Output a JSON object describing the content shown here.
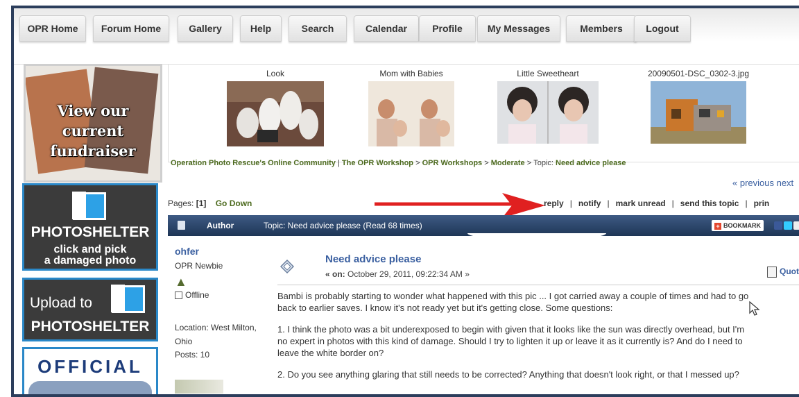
{
  "nav": {
    "items": [
      "OPR Home",
      "Forum Home",
      "Gallery",
      "Help",
      "Search",
      "Calendar",
      "Profile",
      "My Messages",
      "Members",
      "Logout"
    ]
  },
  "sidebar": {
    "fundraiser_text": [
      "View our",
      "current",
      "fundraiser"
    ],
    "photoshelter1": {
      "title": "PHOTOSHELTER",
      "line1": "click and pick",
      "line2": "a damaged photo"
    },
    "photoshelter2": {
      "line1": "Upload to",
      "title": "PHOTOSHELTER"
    },
    "official": "OFFICIAL"
  },
  "gallery": [
    {
      "caption": "Look"
    },
    {
      "caption": "Mom with Babies"
    },
    {
      "caption": "Little Sweetheart"
    },
    {
      "caption": "20090501-DSC_0302-3.jpg"
    }
  ],
  "breadcrumb": {
    "community": "Operation Photo Rescue's Online Community",
    "workshop": "The OPR Workshop",
    "workshops": "OPR Workshops",
    "level": "Moderate",
    "topic_prefix": "Topic:",
    "topic": "Need advice please",
    "sep_bar": "|",
    "sep_gt": ">"
  },
  "prevnext": "« previous next",
  "pages": {
    "label": "Pages:",
    "current": "[1]",
    "go_down": "Go Down"
  },
  "actions": [
    "reply",
    "notify",
    "mark unread",
    "send this topic",
    "prin"
  ],
  "action_sep": "|",
  "header": {
    "author": "Author",
    "topic": "Topic: Need advice please  (Read 68 times)",
    "bookmark": "BOOKMARK"
  },
  "post": {
    "author": "ohfer",
    "rank": "OPR Newbie",
    "status": "Offline",
    "location": "Location: West Milton, Ohio",
    "posts": "Posts: 10",
    "title": "Need advice please",
    "date_on": "« on:",
    "date_value": "October 29, 2011, 09:22:34 AM »",
    "quote": "Quot",
    "body": [
      "Bambi is probably starting to wonder what happened with this pic ... I got carried away a couple of times and had to go",
      "back to earlier saves.  I know it's not ready yet but it's getting close. Some questions:",
      "1. I think the photo was a bit underexposed to begin with given that it looks like the sun was directly overhead, but I'm",
      "no expert in photos with this kind of damage. Should I try to lighten it up or leave it as it currently is? And do I need to",
      "leave the white border on?",
      "2. Do you see anything glaring that still needs to be corrected? Anything that doesn't look right, or that I messed up?"
    ]
  },
  "colors": {
    "header_bar": "#2c4466",
    "link_green": "#4c6a1e",
    "link_blue": "#3a5fa0",
    "arrow_red": "#e02020",
    "accent_blue": "#2a88c8"
  }
}
